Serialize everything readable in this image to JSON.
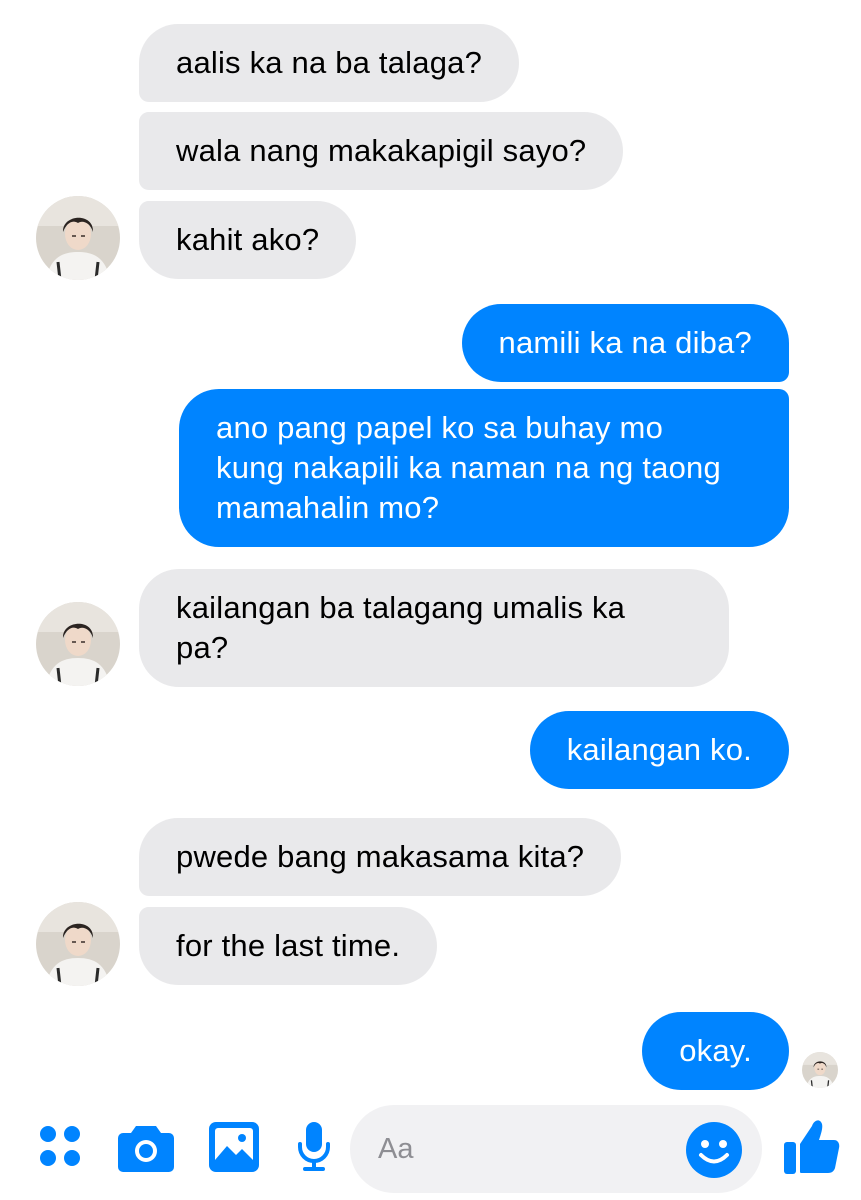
{
  "conversation": {
    "messages": [
      {
        "sender": "other",
        "text": "aalis ka na ba talaga?"
      },
      {
        "sender": "other",
        "text": "wala nang makakapigil sayo?"
      },
      {
        "sender": "other",
        "text": "kahit ako?"
      },
      {
        "sender": "me",
        "text": "namili ka na diba?"
      },
      {
        "sender": "me",
        "lines": [
          "ano pang papel ko sa buhay mo",
          "kung nakapili ka naman na ng taong",
          "mamahalin mo?"
        ]
      },
      {
        "sender": "other",
        "lines": [
          "kailangan ba talagang umalis ka",
          "pa?"
        ]
      },
      {
        "sender": "me",
        "text": "kailangan ko."
      },
      {
        "sender": "other",
        "text": "pwede bang makasama kita?"
      },
      {
        "sender": "other",
        "text": "for the last time."
      },
      {
        "sender": "me",
        "text": "okay."
      }
    ]
  },
  "composer": {
    "placeholder": "Aa",
    "icons": [
      "apps-icon",
      "camera-icon",
      "gallery-icon",
      "microphone-icon",
      "emoji-icon",
      "thumbs-up-icon"
    ]
  },
  "colors": {
    "outgoing_bubble": "#0084ff",
    "incoming_bubble": "#e9e9eb",
    "accent": "#0084ff"
  }
}
